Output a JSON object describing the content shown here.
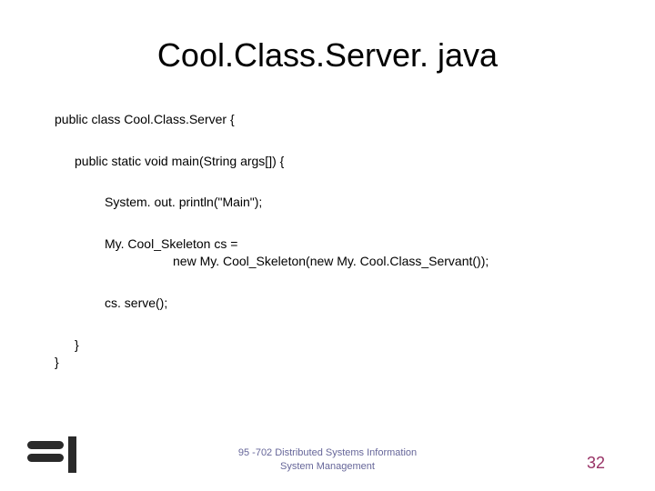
{
  "title": "Cool.Class.Server. java",
  "code": {
    "l1": "public class Cool.Class.Server {",
    "l2": "public static void main(String args[]) {",
    "l3": "System. out. println(\"Main\");",
    "l4": "My. Cool_Skeleton cs =",
    "l5": "new My. Cool_Skeleton(new My. Cool.Class_Servant());",
    "l6": "cs. serve();",
    "l7": "}",
    "l8": "}"
  },
  "footer": {
    "line1": "95 -702 Distributed Systems Information",
    "line2": "System Management"
  },
  "page": "32"
}
